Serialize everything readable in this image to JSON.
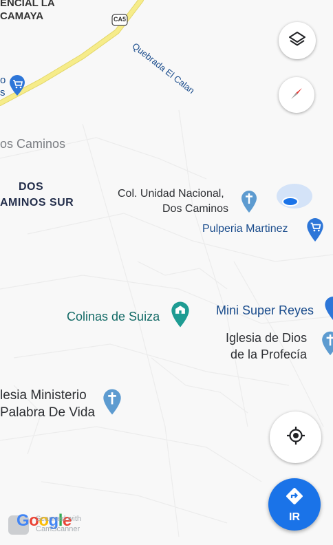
{
  "map": {
    "road_shield": "CA5",
    "labels": {
      "area_top": "ENCIAL LA",
      "area_top2": "CAMAYA",
      "quebrada": "Quebrada El Calan",
      "cut_store_top": "o",
      "cut_store_top2": "s",
      "dos_caminos": "os Caminos",
      "dos_caminos_sur_1": "DOS",
      "dos_caminos_sur_2": "AMINOS SUR",
      "col_unidad_1": "Col. Unidad Nacional,",
      "col_unidad_2": "Dos Caminos",
      "pulperia": "Pulperia Martinez",
      "colinas": "Colinas de Suiza",
      "mini_super": "Mini Super Reyes",
      "iglesia_dios_1": "Iglesia de Dios",
      "iglesia_dios_2": "de la Profecía",
      "iglesia_min_1": "lesia Ministerio",
      "iglesia_min_2": "Palabra De Vida"
    },
    "icons": {
      "shopping": "shopping-cart-icon",
      "church": "church-cross-icon",
      "landmark": "landmark-icon"
    }
  },
  "controls": {
    "layers_icon": "layers-icon",
    "compass_icon": "compass-icon",
    "location_icon": "my-location-icon",
    "directions_label": "IR"
  },
  "branding": {
    "google": "Google",
    "watermark_1": "Scanned with",
    "watermark_2": "CamScanner"
  },
  "colors": {
    "road_yellow": "#f6ec8a",
    "accent_blue": "#1a73e8",
    "pin_blue": "#5d9bd0",
    "shop_blue": "#2d76d8",
    "teal": "#1e9c93",
    "navy_text": "#222d4a"
  }
}
